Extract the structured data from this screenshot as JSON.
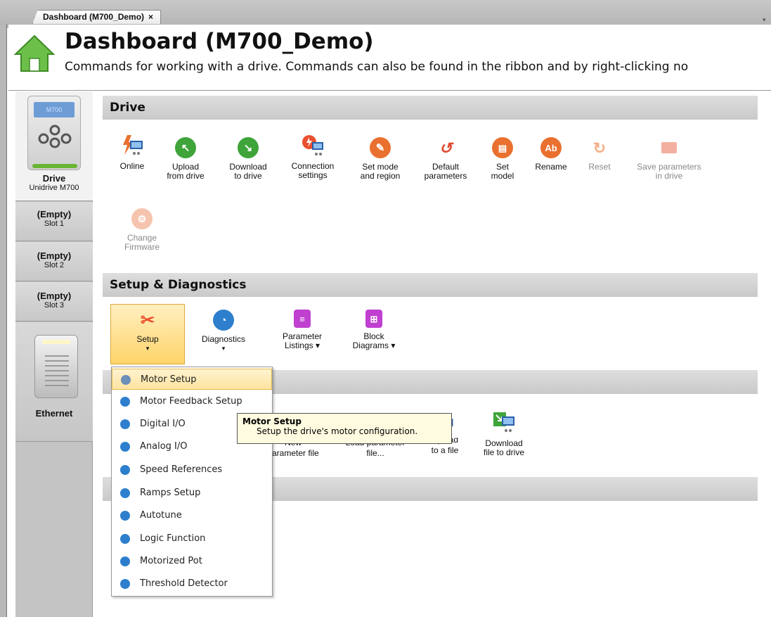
{
  "tab": {
    "label": "Dashboard (M700_Demo)",
    "close": "×"
  },
  "header": {
    "title": "Dashboard (M700_Demo)",
    "subtitle": "Commands for working with a drive. Commands can also be found in the ribbon and by right-clicking no"
  },
  "slots": {
    "drive": {
      "lcd": "M700",
      "title": "Drive",
      "subtitle": "Unidrive M700"
    },
    "items": [
      {
        "title": "(Empty)",
        "subtitle": "Slot 1"
      },
      {
        "title": "(Empty)",
        "subtitle": "Slot 2"
      },
      {
        "title": "(Empty)",
        "subtitle": "Slot 3"
      }
    ],
    "ethernet": {
      "title": "Ethernet"
    }
  },
  "sections": {
    "drive": "Drive",
    "setup": "Setup & Diagnostics"
  },
  "drive_commands": [
    {
      "line1": "Online",
      "line2": ""
    },
    {
      "line1": "Upload",
      "line2": "from drive"
    },
    {
      "line1": "Download",
      "line2": "to drive"
    },
    {
      "line1": "Connection",
      "line2": "settings"
    },
    {
      "line1": "Set mode",
      "line2": "and region"
    },
    {
      "line1": "Default",
      "line2": "parameters"
    },
    {
      "line1": "Set",
      "line2": "model"
    },
    {
      "line1": "Rename",
      "line2": ""
    },
    {
      "line1": "Reset",
      "line2": ""
    },
    {
      "line1": "Save parameters",
      "line2": "in drive"
    },
    {
      "line1": "Change",
      "line2": "Firmware"
    }
  ],
  "setup_commands": [
    {
      "line1": "Setup",
      "line2": "▾"
    },
    {
      "line1": "Diagnostics",
      "line2": "▾"
    },
    {
      "line1": "Parameter",
      "line2": "Listings ▾"
    },
    {
      "line1": "Block",
      "line2": "Diagrams ▾"
    }
  ],
  "file_commands": [
    {
      "line1": "New",
      "line2": "parameter file"
    },
    {
      "line1": "Load parameter",
      "line2": "file..."
    },
    {
      "line1": "Upload",
      "line2": "to a file"
    },
    {
      "line1": "Download",
      "line2": "file to drive"
    }
  ],
  "menu": {
    "items": [
      "Motor Setup",
      "Motor Feedback Setup",
      "Digital I/O",
      "Analog I/O",
      "Speed References",
      "Ramps Setup",
      "Autotune",
      "Logic Function",
      "Motorized Pot",
      "Threshold Detector"
    ]
  },
  "tooltip": {
    "title": "Motor Setup",
    "description": "Setup the drive's motor configuration."
  },
  "colors": {
    "accent_green": "#69b534",
    "menu_highlight": "#fde3a0",
    "icon_blue": "#2d7fcd",
    "icon_orange": "#e9702f"
  }
}
